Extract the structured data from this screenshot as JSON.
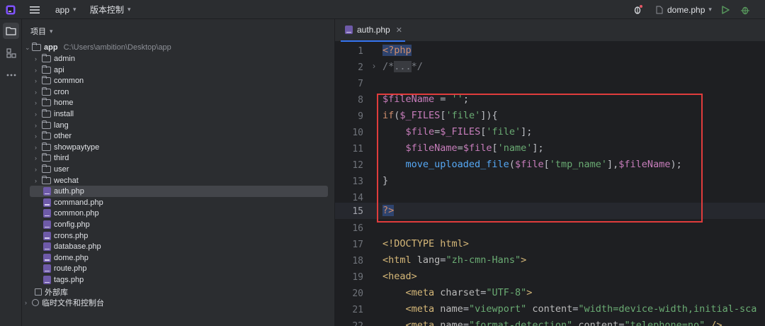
{
  "topbar": {
    "project_name": "app",
    "vcs_label": "版本控制",
    "run_config": "dome.php"
  },
  "project_panel": {
    "title": "项目",
    "root": {
      "name": "app",
      "path": "C:\\Users\\ambition\\Desktop\\app"
    },
    "folders": [
      "admin",
      "api",
      "common",
      "cron",
      "home",
      "install",
      "lang",
      "other",
      "showpaytype",
      "third",
      "user",
      "wechat"
    ],
    "files": [
      "auth.php",
      "command.php",
      "common.php",
      "config.php",
      "crons.php",
      "database.php",
      "dome.php",
      "route.php",
      "tags.php"
    ],
    "selected_file": "auth.php",
    "external_libraries": "外部库",
    "scratches": "临时文件和控制台"
  },
  "editor": {
    "tab_name": "auth.php",
    "current_line": 15,
    "line_numbers": [
      "1",
      "2",
      "7",
      "8",
      "9",
      "10",
      "11",
      "12",
      "13",
      "14",
      "15",
      "16",
      "17",
      "18",
      "19",
      "20",
      "21",
      "22"
    ]
  }
}
